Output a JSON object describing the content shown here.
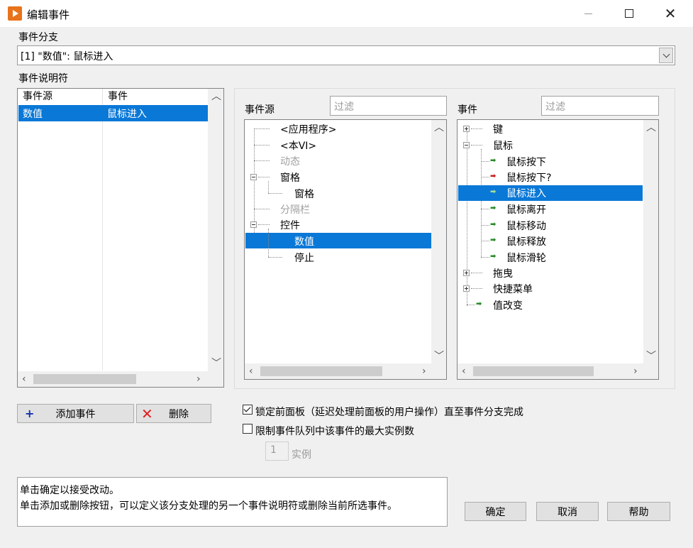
{
  "window": {
    "title": "编辑事件",
    "minimize": "—",
    "maximize": "☐",
    "close": "✕"
  },
  "branch": {
    "label": "事件分支",
    "value": "[1] \"数值\": 鼠标进入"
  },
  "specifiers": {
    "label": "事件说明符",
    "headers": [
      "事件源",
      "事件"
    ],
    "rows": [
      {
        "source": "数值",
        "event": "鼠标进入"
      }
    ]
  },
  "sources": {
    "label": "事件源",
    "filter_placeholder": "过滤",
    "items": [
      {
        "label": "<应用程序>",
        "enabled": true
      },
      {
        "label": "<本VI>",
        "enabled": true
      },
      {
        "label": "动态",
        "enabled": false
      },
      {
        "label": "窗格",
        "enabled": true,
        "expanded": true
      },
      {
        "label": "窗格",
        "enabled": true
      },
      {
        "label": "分隔栏",
        "enabled": false
      },
      {
        "label": "控件",
        "enabled": true,
        "expanded": true
      },
      {
        "label": "数值",
        "enabled": true,
        "selected": true
      },
      {
        "label": "停止",
        "enabled": true
      }
    ]
  },
  "events": {
    "label": "事件",
    "filter_placeholder": "过滤",
    "items": [
      {
        "label": "键",
        "expanded": false
      },
      {
        "label": "鼠标",
        "expanded": true
      },
      {
        "label": "鼠标按下"
      },
      {
        "label": "鼠标按下?"
      },
      {
        "label": "鼠标进入",
        "selected": true
      },
      {
        "label": "鼠标离开"
      },
      {
        "label": "鼠标移动"
      },
      {
        "label": "鼠标释放"
      },
      {
        "label": "鼠标滑轮"
      },
      {
        "label": "拖曳",
        "expanded": false
      },
      {
        "label": "快捷菜单",
        "expanded": false
      },
      {
        "label": "值改变"
      }
    ]
  },
  "buttons": {
    "add": "添加事件",
    "delete": "删除",
    "ok": "确定",
    "cancel": "取消",
    "help": "帮助"
  },
  "options": {
    "lock_label": "锁定前面板（延迟处理前面板的用户操作）直至事件分支完成",
    "lock_checked": true,
    "limit_label": "限制事件队列中该事件的最大实例数",
    "limit_checked": false,
    "instances_value": "1",
    "instances_label": "实例"
  },
  "help_text": {
    "line1": "单击确定以接受改动。",
    "line2": "单击添加或删除按钮，可以定义该分支处理的另一个事件说明符或删除当前所选事件。"
  },
  "colors": {
    "selection": "#0a78d7",
    "accent_icon": "#e8731a"
  }
}
